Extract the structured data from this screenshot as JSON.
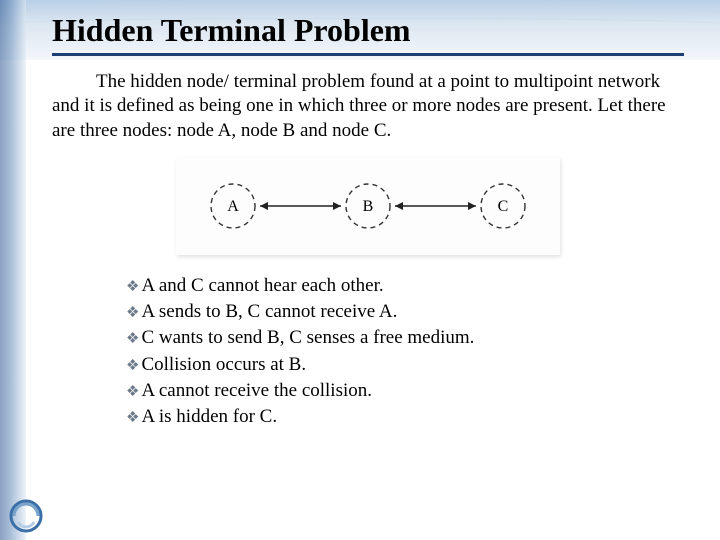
{
  "title": "Hidden Terminal Problem",
  "paragraph": "The hidden node/ terminal problem found at a point to multipoint network and it is defined as being one in which three or more nodes are present. Let there are three nodes: node A, node B and node C.",
  "diagram": {
    "nodes": [
      "A",
      "B",
      "C"
    ],
    "edges": [
      [
        "A",
        "B"
      ],
      [
        "B",
        "C"
      ]
    ]
  },
  "bullets": [
    "A and C cannot hear each other.",
    "A sends to B, C cannot receive A.",
    "C wants to send B, C senses a free medium.",
    "Collision occurs at B.",
    "A cannot receive the collision.",
    "A is hidden for C."
  ],
  "icons": {
    "bullet": "❖"
  },
  "colors": {
    "underline": "#1b3e73",
    "bullet": "#6d7a8a"
  }
}
